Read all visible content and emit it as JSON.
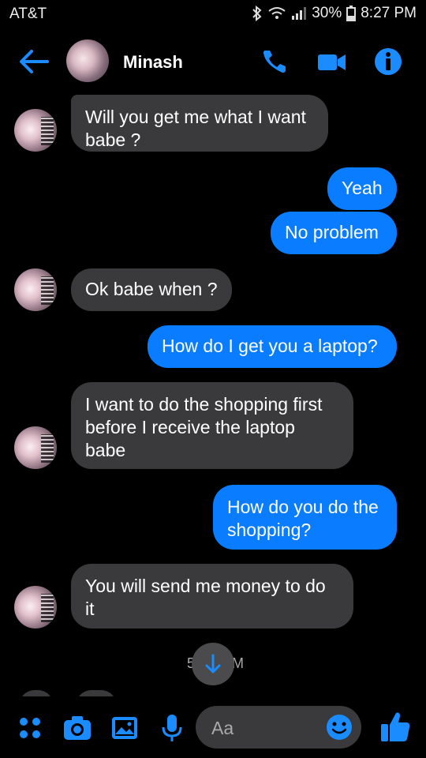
{
  "status_bar": {
    "carrier": "AT&T",
    "battery": "30%",
    "time": "8:27 PM"
  },
  "header": {
    "contact_name": "Minash"
  },
  "messages": [
    {
      "from": "them",
      "text": "Will you get me what I want babe ?"
    },
    {
      "from": "me",
      "text": "Yeah"
    },
    {
      "from": "me",
      "text": "No problem"
    },
    {
      "from": "them",
      "text": "Ok babe when ?"
    },
    {
      "from": "me",
      "text": "How do I get you a laptop?"
    },
    {
      "from": "them",
      "text": "I want to do the shopping first before I receive the laptop babe"
    },
    {
      "from": "me",
      "text": "How do you do the shopping?"
    },
    {
      "from": "them",
      "text": "You will send me money to do it"
    }
  ],
  "timestamp_fragment_left": "5",
  "timestamp_fragment_right": "M",
  "composer": {
    "placeholder": "Aa"
  },
  "colors": {
    "accent": "#0a7cff",
    "incoming_bubble": "#3a3a3c",
    "background": "#000000"
  }
}
